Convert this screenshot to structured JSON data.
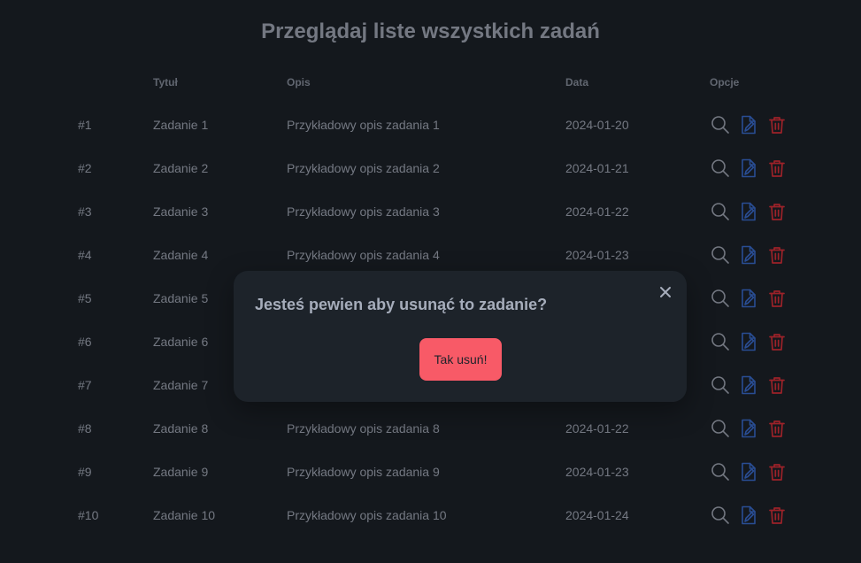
{
  "page": {
    "title": "Przeglądaj liste wszystkich zadań"
  },
  "table": {
    "headers": {
      "id": "",
      "title": "Tytuł",
      "description": "Opis",
      "date": "Data",
      "options": "Opcje"
    },
    "rows": [
      {
        "id": "#1",
        "title": "Zadanie 1",
        "description": "Przykładowy opis zadania 1",
        "date": "2024-01-20"
      },
      {
        "id": "#2",
        "title": "Zadanie 2",
        "description": "Przykładowy opis zadania 2",
        "date": "2024-01-21"
      },
      {
        "id": "#3",
        "title": "Zadanie 3",
        "description": "Przykładowy opis zadania 3",
        "date": "2024-01-22"
      },
      {
        "id": "#4",
        "title": "Zadanie 4",
        "description": "Przykładowy opis zadania 4",
        "date": "2024-01-23"
      },
      {
        "id": "#5",
        "title": "Zadanie 5",
        "description": "",
        "date": ""
      },
      {
        "id": "#6",
        "title": "Zadanie 6",
        "description": "",
        "date": ""
      },
      {
        "id": "#7",
        "title": "Zadanie 7",
        "description": "",
        "date": ""
      },
      {
        "id": "#8",
        "title": "Zadanie 8",
        "description": "Przykładowy opis zadania 8",
        "date": "2024-01-22"
      },
      {
        "id": "#9",
        "title": "Zadanie 9",
        "description": "Przykładowy opis zadania 9",
        "date": "2024-01-23"
      },
      {
        "id": "#10",
        "title": "Zadanie 10",
        "description": "Przykładowy opis zadania 10",
        "date": "2024-01-24"
      }
    ],
    "row_actions": [
      {
        "name": "view",
        "icon": "magnifier-icon",
        "color": "#a6adbb"
      },
      {
        "name": "edit",
        "icon": "document-edit-icon",
        "color": "#3b6fd4"
      },
      {
        "name": "delete",
        "icon": "trash-icon",
        "color": "#e0313b"
      }
    ]
  },
  "modal": {
    "title": "Jesteś pewien aby usunąć to zadanie?",
    "close_icon": "close-icon",
    "confirm_label": "Tak usuń!"
  },
  "colors": {
    "background": "#1d232a",
    "text": "#a6adbb",
    "confirm_button": "#f85a67",
    "edit_icon": "#3b6fd4",
    "delete_icon": "#e0313b"
  }
}
